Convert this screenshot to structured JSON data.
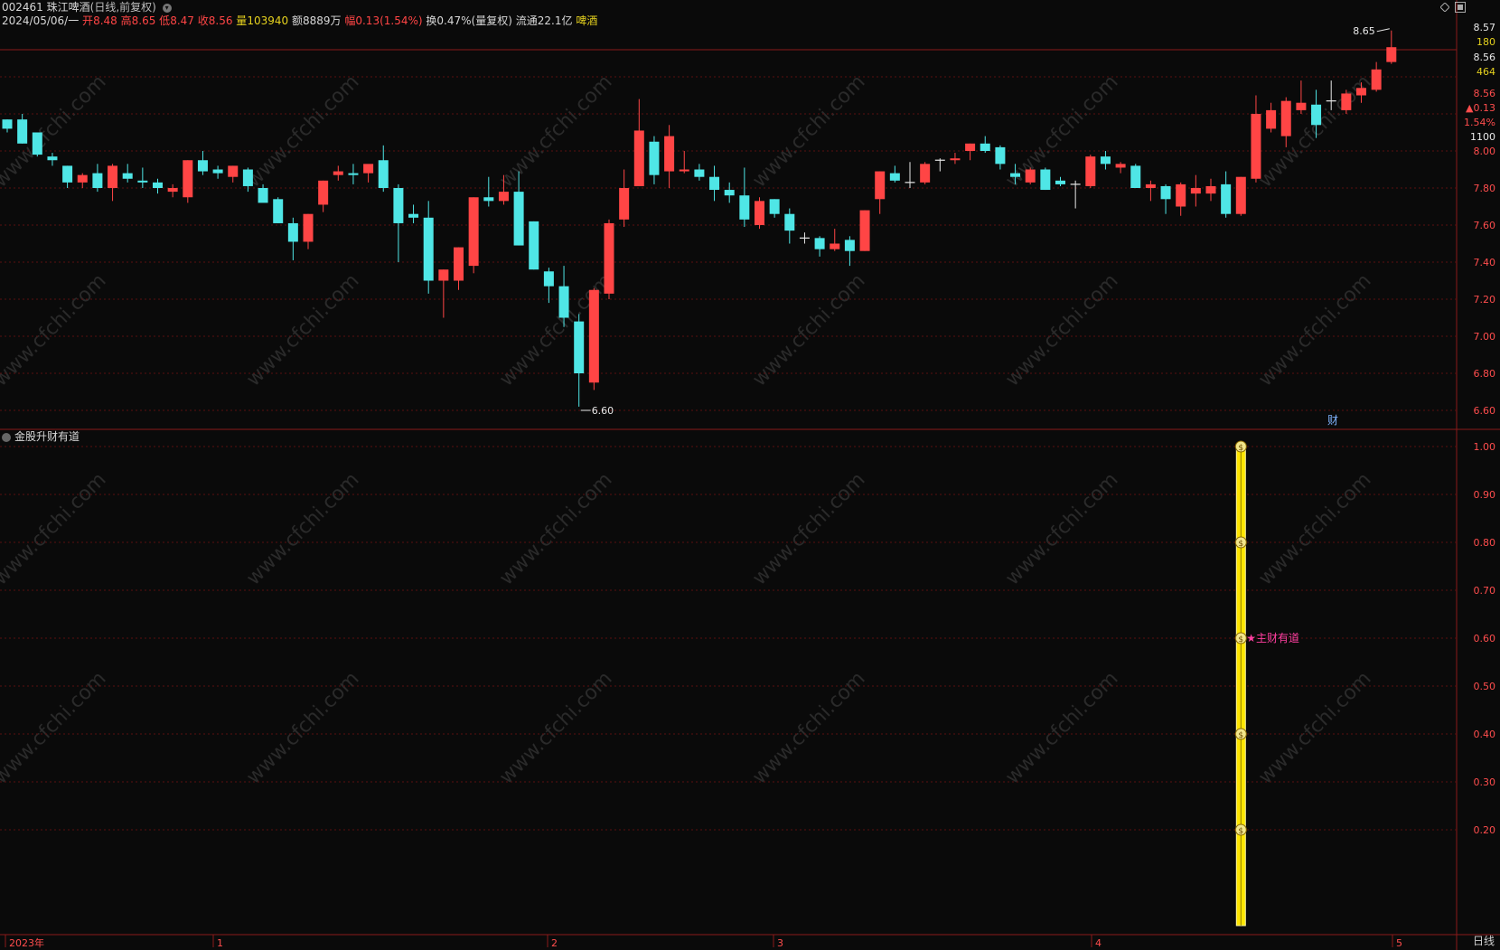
{
  "header": {
    "code": "002461",
    "name": "珠江啤酒",
    "mode": "(日线,前复权)",
    "date": "2024/05/06/一",
    "open_label": "开",
    "open": "8.48",
    "high_label": "高",
    "high": "8.65",
    "low_label": "低",
    "low": "8.47",
    "close_label": "收",
    "close": "8.56",
    "vol_label": "量",
    "vol": "103940",
    "amount_label": "额",
    "amount": "8889万",
    "chg_label": "幅",
    "chg": "0.13(1.54%)",
    "turnover_label": "换",
    "turnover": "0.47%(量复权)",
    "float_label": "流通",
    "float": "22.1亿",
    "sector": "啤酒"
  },
  "right_quote": {
    "price_top": "8.57",
    "v1": "180",
    "price2": "8.56",
    "v2": "464",
    "last": "8.56",
    "chg": "▲0.13",
    "pct": "1.54%",
    "vol": "1100"
  },
  "colors": {
    "up": "#ff4545",
    "down": "#4fe6e6",
    "bg": "#0a0a0a",
    "grid": "#5a1010",
    "indicator": "#ffe600",
    "indicator_label": "#ff3fa0"
  },
  "chart_data": {
    "type": "candlestick",
    "y_ticks": [
      6.6,
      6.8,
      7.0,
      7.2,
      7.4,
      7.6,
      7.8,
      8.0
    ],
    "y_tick_labels": [
      "6.60",
      "6.80",
      "7.00",
      "7.20",
      "7.40",
      "7.60",
      "7.80",
      "8.00"
    ],
    "high_marker": "8.65",
    "low_marker": "6.60",
    "finance_marker": "财",
    "x_labels": [
      "2023年",
      "1",
      "2",
      "3",
      "4",
      "5"
    ],
    "candles": [
      {
        "o": 8.17,
        "h": 8.17,
        "l": 8.1,
        "c": 8.12
      },
      {
        "o": 8.17,
        "h": 8.2,
        "l": 8.04,
        "c": 8.04
      },
      {
        "o": 8.1,
        "h": 8.1,
        "l": 7.97,
        "c": 7.98
      },
      {
        "o": 7.97,
        "h": 7.99,
        "l": 7.92,
        "c": 7.95
      },
      {
        "o": 7.92,
        "h": 7.92,
        "l": 7.8,
        "c": 7.83
      },
      {
        "o": 7.83,
        "h": 7.88,
        "l": 7.8,
        "c": 7.87
      },
      {
        "o": 7.88,
        "h": 7.93,
        "l": 7.78,
        "c": 7.8
      },
      {
        "o": 7.8,
        "h": 7.93,
        "l": 7.73,
        "c": 7.92
      },
      {
        "o": 7.88,
        "h": 7.93,
        "l": 7.83,
        "c": 7.85
      },
      {
        "o": 7.84,
        "h": 7.91,
        "l": 7.8,
        "c": 7.83
      },
      {
        "o": 7.83,
        "h": 7.85,
        "l": 7.77,
        "c": 7.8
      },
      {
        "o": 7.78,
        "h": 7.82,
        "l": 7.75,
        "c": 7.8
      },
      {
        "o": 7.75,
        "h": 7.95,
        "l": 7.72,
        "c": 7.95
      },
      {
        "o": 7.95,
        "h": 8.0,
        "l": 7.87,
        "c": 7.89
      },
      {
        "o": 7.9,
        "h": 7.92,
        "l": 7.85,
        "c": 7.88
      },
      {
        "o": 7.86,
        "h": 7.92,
        "l": 7.83,
        "c": 7.92
      },
      {
        "o": 7.9,
        "h": 7.91,
        "l": 7.78,
        "c": 7.81
      },
      {
        "o": 7.8,
        "h": 7.82,
        "l": 7.73,
        "c": 7.72
      },
      {
        "o": 7.74,
        "h": 7.75,
        "l": 7.61,
        "c": 7.61
      },
      {
        "o": 7.61,
        "h": 7.64,
        "l": 7.41,
        "c": 7.51
      },
      {
        "o": 7.51,
        "h": 7.66,
        "l": 7.47,
        "c": 7.66
      },
      {
        "o": 7.71,
        "h": 7.84,
        "l": 7.67,
        "c": 7.84
      },
      {
        "o": 7.87,
        "h": 7.92,
        "l": 7.84,
        "c": 7.89
      },
      {
        "o": 7.88,
        "h": 7.93,
        "l": 7.82,
        "c": 7.87
      },
      {
        "o": 7.88,
        "h": 7.91,
        "l": 7.83,
        "c": 7.93
      },
      {
        "o": 7.95,
        "h": 8.03,
        "l": 7.78,
        "c": 7.8
      },
      {
        "o": 7.8,
        "h": 7.82,
        "l": 7.4,
        "c": 7.61
      },
      {
        "o": 7.66,
        "h": 7.71,
        "l": 7.61,
        "c": 7.64
      },
      {
        "o": 7.64,
        "h": 7.73,
        "l": 7.23,
        "c": 7.3
      },
      {
        "o": 7.3,
        "h": 7.36,
        "l": 7.1,
        "c": 7.36
      },
      {
        "o": 7.3,
        "h": 7.48,
        "l": 7.25,
        "c": 7.48
      },
      {
        "o": 7.38,
        "h": 7.75,
        "l": 7.34,
        "c": 7.75
      },
      {
        "o": 7.75,
        "h": 7.86,
        "l": 7.7,
        "c": 7.73
      },
      {
        "o": 7.73,
        "h": 7.87,
        "l": 7.71,
        "c": 7.78
      },
      {
        "o": 7.78,
        "h": 7.89,
        "l": 7.49,
        "c": 7.49
      },
      {
        "o": 7.62,
        "h": 7.62,
        "l": 7.36,
        "c": 7.36
      },
      {
        "o": 7.35,
        "h": 7.37,
        "l": 7.18,
        "c": 7.27
      },
      {
        "o": 7.27,
        "h": 7.38,
        "l": 7.05,
        "c": 7.1
      },
      {
        "o": 7.08,
        "h": 7.12,
        "l": 6.62,
        "c": 6.8
      },
      {
        "o": 6.75,
        "h": 7.26,
        "l": 6.71,
        "c": 7.25
      },
      {
        "o": 7.23,
        "h": 7.63,
        "l": 7.2,
        "c": 7.61
      },
      {
        "o": 7.63,
        "h": 7.9,
        "l": 7.59,
        "c": 7.8
      },
      {
        "o": 7.81,
        "h": 8.28,
        "l": 7.81,
        "c": 8.11
      },
      {
        "o": 8.05,
        "h": 8.08,
        "l": 7.82,
        "c": 7.87
      },
      {
        "o": 7.89,
        "h": 8.14,
        "l": 7.8,
        "c": 8.08
      },
      {
        "o": 7.89,
        "h": 8.0,
        "l": 7.88,
        "c": 7.9
      },
      {
        "o": 7.9,
        "h": 7.93,
        "l": 7.84,
        "c": 7.86
      },
      {
        "o": 7.86,
        "h": 7.92,
        "l": 7.73,
        "c": 7.79
      },
      {
        "o": 7.79,
        "h": 7.83,
        "l": 7.72,
        "c": 7.76
      },
      {
        "o": 7.76,
        "h": 7.91,
        "l": 7.59,
        "c": 7.63
      },
      {
        "o": 7.6,
        "h": 7.75,
        "l": 7.58,
        "c": 7.73
      },
      {
        "o": 7.74,
        "h": 7.74,
        "l": 7.64,
        "c": 7.66
      },
      {
        "o": 7.66,
        "h": 7.69,
        "l": 7.5,
        "c": 7.57
      },
      {
        "o": 7.53,
        "h": 7.56,
        "l": 7.5,
        "c": 7.53
      },
      {
        "o": 7.53,
        "h": 7.54,
        "l": 7.43,
        "c": 7.47
      },
      {
        "o": 7.47,
        "h": 7.58,
        "l": 7.46,
        "c": 7.5
      },
      {
        "o": 7.52,
        "h": 7.54,
        "l": 7.38,
        "c": 7.46
      },
      {
        "o": 7.46,
        "h": 7.68,
        "l": 7.46,
        "c": 7.68
      },
      {
        "o": 7.74,
        "h": 7.89,
        "l": 7.66,
        "c": 7.89
      },
      {
        "o": 7.88,
        "h": 7.92,
        "l": 7.83,
        "c": 7.84
      },
      {
        "o": 7.83,
        "h": 7.94,
        "l": 7.8,
        "c": 7.83
      },
      {
        "o": 7.83,
        "h": 7.94,
        "l": 7.82,
        "c": 7.93
      },
      {
        "o": 7.95,
        "h": 7.96,
        "l": 7.89,
        "c": 7.95
      },
      {
        "o": 7.95,
        "h": 7.99,
        "l": 7.93,
        "c": 7.96
      },
      {
        "o": 8.0,
        "h": 8.04,
        "l": 7.95,
        "c": 8.04
      },
      {
        "o": 8.04,
        "h": 8.08,
        "l": 7.99,
        "c": 8.0
      },
      {
        "o": 8.02,
        "h": 8.03,
        "l": 7.9,
        "c": 7.93
      },
      {
        "o": 7.88,
        "h": 7.93,
        "l": 7.82,
        "c": 7.86
      },
      {
        "o": 7.83,
        "h": 7.91,
        "l": 7.82,
        "c": 7.9
      },
      {
        "o": 7.9,
        "h": 7.91,
        "l": 7.79,
        "c": 7.79
      },
      {
        "o": 7.84,
        "h": 7.86,
        "l": 7.81,
        "c": 7.82
      },
      {
        "o": 7.82,
        "h": 7.84,
        "l": 7.69,
        "c": 7.82
      },
      {
        "o": 7.81,
        "h": 7.98,
        "l": 7.8,
        "c": 7.97
      },
      {
        "o": 7.97,
        "h": 8.0,
        "l": 7.9,
        "c": 7.93
      },
      {
        "o": 7.91,
        "h": 7.94,
        "l": 7.88,
        "c": 7.93
      },
      {
        "o": 7.92,
        "h": 7.93,
        "l": 7.8,
        "c": 7.8
      },
      {
        "o": 7.8,
        "h": 7.84,
        "l": 7.73,
        "c": 7.82
      },
      {
        "o": 7.81,
        "h": 7.82,
        "l": 7.66,
        "c": 7.74
      },
      {
        "o": 7.7,
        "h": 7.83,
        "l": 7.65,
        "c": 7.82
      },
      {
        "o": 7.77,
        "h": 7.87,
        "l": 7.7,
        "c": 7.8
      },
      {
        "o": 7.77,
        "h": 7.85,
        "l": 7.73,
        "c": 7.81
      },
      {
        "o": 7.82,
        "h": 7.89,
        "l": 7.64,
        "c": 7.66
      },
      {
        "o": 7.66,
        "h": 7.86,
        "l": 7.65,
        "c": 7.86
      },
      {
        "o": 7.85,
        "h": 8.3,
        "l": 7.83,
        "c": 8.2
      },
      {
        "o": 8.12,
        "h": 8.26,
        "l": 8.1,
        "c": 8.22
      },
      {
        "o": 8.08,
        "h": 8.29,
        "l": 8.02,
        "c": 8.27
      },
      {
        "o": 8.22,
        "h": 8.38,
        "l": 8.2,
        "c": 8.26
      },
      {
        "o": 8.25,
        "h": 8.33,
        "l": 8.07,
        "c": 8.14
      },
      {
        "o": 8.27,
        "h": 8.38,
        "l": 8.22,
        "c": 8.27
      },
      {
        "o": 8.22,
        "h": 8.33,
        "l": 8.2,
        "c": 8.31
      },
      {
        "o": 8.3,
        "h": 8.37,
        "l": 8.26,
        "c": 8.34
      },
      {
        "o": 8.33,
        "h": 8.48,
        "l": 8.32,
        "c": 8.44
      },
      {
        "o": 8.48,
        "h": 8.65,
        "l": 8.47,
        "c": 8.56
      }
    ]
  },
  "indicator": {
    "title": "金股升财有道",
    "label": "★主财有道",
    "y_tick_labels": [
      "1.00",
      "0.90",
      "0.80",
      "0.70",
      "0.60",
      "0.50",
      "0.40",
      "0.30",
      "0.20"
    ],
    "y_ticks": [
      1.0,
      0.9,
      0.8,
      0.7,
      0.6,
      0.5,
      0.4,
      0.3,
      0.2
    ],
    "bar_candle_index": 82,
    "bar_value": 1.0,
    "coin_values": [
      1.0,
      0.8,
      0.6,
      0.4,
      0.2
    ],
    "coin_symbol": "$"
  },
  "period": "日线"
}
